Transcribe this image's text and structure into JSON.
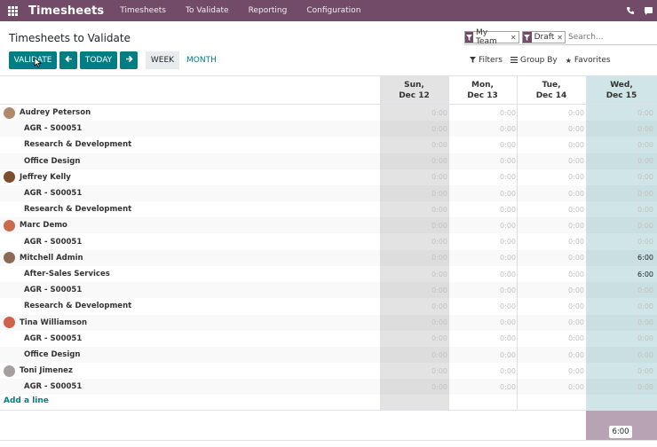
{
  "navbar": {
    "app_title": "Timesheets",
    "menu": [
      "Timesheets",
      "To Validate",
      "Reporting",
      "Configuration"
    ],
    "bg_color": "#714b67",
    "icons": [
      "apps-grid-icon",
      "phone-icon",
      "chat-icon"
    ]
  },
  "control_panel": {
    "title": "Timesheets to Validate",
    "facets": [
      {
        "icon": "filter-icon",
        "label": "My Team"
      },
      {
        "icon": "filter-icon",
        "label": "Draft"
      }
    ],
    "search_placeholder": "Search...",
    "buttons": {
      "validate": "VALIDATE",
      "today": "TODAY",
      "week": "WEEK",
      "month": "MONTH"
    },
    "view_options": {
      "filters": "Filters",
      "group_by": "Group By",
      "favorites": "Favorites"
    },
    "accent_color": "#017e84"
  },
  "grid": {
    "columns": [
      {
        "day": "Sun,",
        "date": "Dec 12"
      },
      {
        "day": "Mon,",
        "date": "Dec 13"
      },
      {
        "day": "Tue,",
        "date": "Dec 14"
      },
      {
        "day": "Wed,",
        "date": "Dec 15"
      }
    ],
    "rows": [
      {
        "type": "employee",
        "label": "Audrey Peterson",
        "values": [
          "0:00",
          "0:00",
          "0:00",
          "0:00"
        ]
      },
      {
        "type": "task",
        "label": "AGR - S00051",
        "values": [
          "0:00",
          "0:00",
          "0:00",
          "0:00"
        ]
      },
      {
        "type": "task",
        "label": "Research & Development",
        "values": [
          "0:00",
          "0:00",
          "0:00",
          "0:00"
        ]
      },
      {
        "type": "task",
        "label": "Office Design",
        "values": [
          "0:00",
          "0:00",
          "0:00",
          "0:00"
        ]
      },
      {
        "type": "employee",
        "label": "Jeffrey Kelly",
        "values": [
          "0:00",
          "0:00",
          "0:00",
          "0:00"
        ]
      },
      {
        "type": "task",
        "label": "AGR - S00051",
        "values": [
          "0:00",
          "0:00",
          "0:00",
          "0:00"
        ]
      },
      {
        "type": "task",
        "label": "Research & Development",
        "values": [
          "0:00",
          "0:00",
          "0:00",
          "0:00"
        ]
      },
      {
        "type": "employee",
        "label": "Marc Demo",
        "values": [
          "0:00",
          "0:00",
          "0:00",
          "0:00"
        ]
      },
      {
        "type": "task",
        "label": "AGR - S00051",
        "values": [
          "0:00",
          "0:00",
          "0:00",
          "0:00"
        ]
      },
      {
        "type": "employee",
        "label": "Mitchell Admin",
        "values": [
          "0:00",
          "0:00",
          "0:00",
          "6:00"
        ]
      },
      {
        "type": "task",
        "label": "After-Sales Services",
        "values": [
          "0:00",
          "0:00",
          "0:00",
          "6:00"
        ]
      },
      {
        "type": "task",
        "label": "AGR - S00051",
        "values": [
          "0:00",
          "0:00",
          "0:00",
          "0:00"
        ]
      },
      {
        "type": "task",
        "label": "Research & Development",
        "values": [
          "0:00",
          "0:00",
          "0:00",
          "0:00"
        ]
      },
      {
        "type": "employee",
        "label": "Tina Williamson",
        "values": [
          "0:00",
          "0:00",
          "0:00",
          "0:00"
        ]
      },
      {
        "type": "task",
        "label": "AGR - S00051",
        "values": [
          "0:00",
          "0:00",
          "0:00",
          "0:00"
        ]
      },
      {
        "type": "task",
        "label": "Office Design",
        "values": [
          "0:00",
          "0:00",
          "0:00",
          "0:00"
        ]
      },
      {
        "type": "employee",
        "label": "Toni Jimenez",
        "values": [
          "0:00",
          "0:00",
          "0:00",
          "0:00"
        ]
      },
      {
        "type": "task",
        "label": "AGR - S00051",
        "values": [
          "0:00",
          "0:00",
          "0:00",
          "0:00"
        ]
      }
    ],
    "add_line": "Add a line",
    "total_wed": "6:00"
  }
}
